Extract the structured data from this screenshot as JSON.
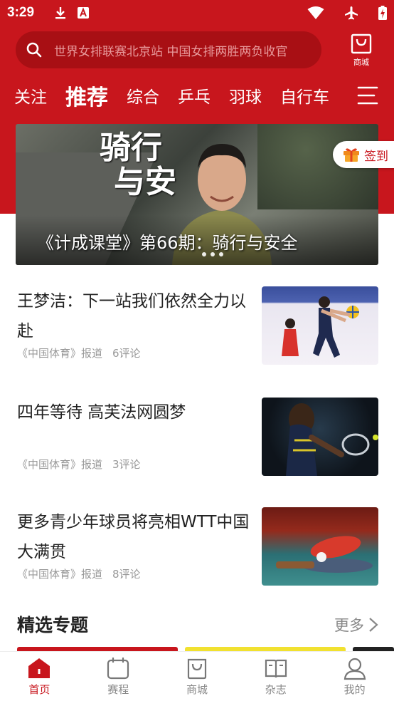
{
  "status_bar": {
    "time": "3:29"
  },
  "search": {
    "placeholder": "世界女排联赛北京站 中国女排两胜两负收官"
  },
  "mall_top": {
    "label": "商城"
  },
  "channels": [
    "关注",
    "推荐",
    "综合",
    "乒乓",
    "羽球",
    "自行车"
  ],
  "active_channel": "推荐",
  "banner": {
    "caption": "《计成课堂》第66期：骑行与安全",
    "overlay_text": [
      "骑行",
      "与安"
    ]
  },
  "checkin": {
    "label": "签到"
  },
  "news": [
    {
      "title": "王梦洁：下一站我们依然全力以赴",
      "source": "《中国体育》报道",
      "comments": "6评论"
    },
    {
      "title": "四年等待 高芙法网圆梦",
      "source": "《中国体育》报道",
      "comments": "3评论"
    },
    {
      "title": "更多青少年球员将亮相WTT中国大满贯",
      "source": "《中国体育》报道",
      "comments": "8评论"
    }
  ],
  "featured": {
    "title": "精选专题",
    "more": "更多"
  },
  "bottom_nav": [
    {
      "label": "首页",
      "icon": "home-icon",
      "active": true
    },
    {
      "label": "赛程",
      "icon": "calendar-icon",
      "active": false
    },
    {
      "label": "商城",
      "icon": "shopping-bag-icon",
      "active": false
    },
    {
      "label": "杂志",
      "icon": "magazine-icon",
      "active": false
    },
    {
      "label": "我的",
      "icon": "user-icon",
      "active": false
    }
  ],
  "colors": {
    "brand_red": "#c8161d",
    "search_bg": "#a80f14",
    "meta_gray": "#999999"
  }
}
